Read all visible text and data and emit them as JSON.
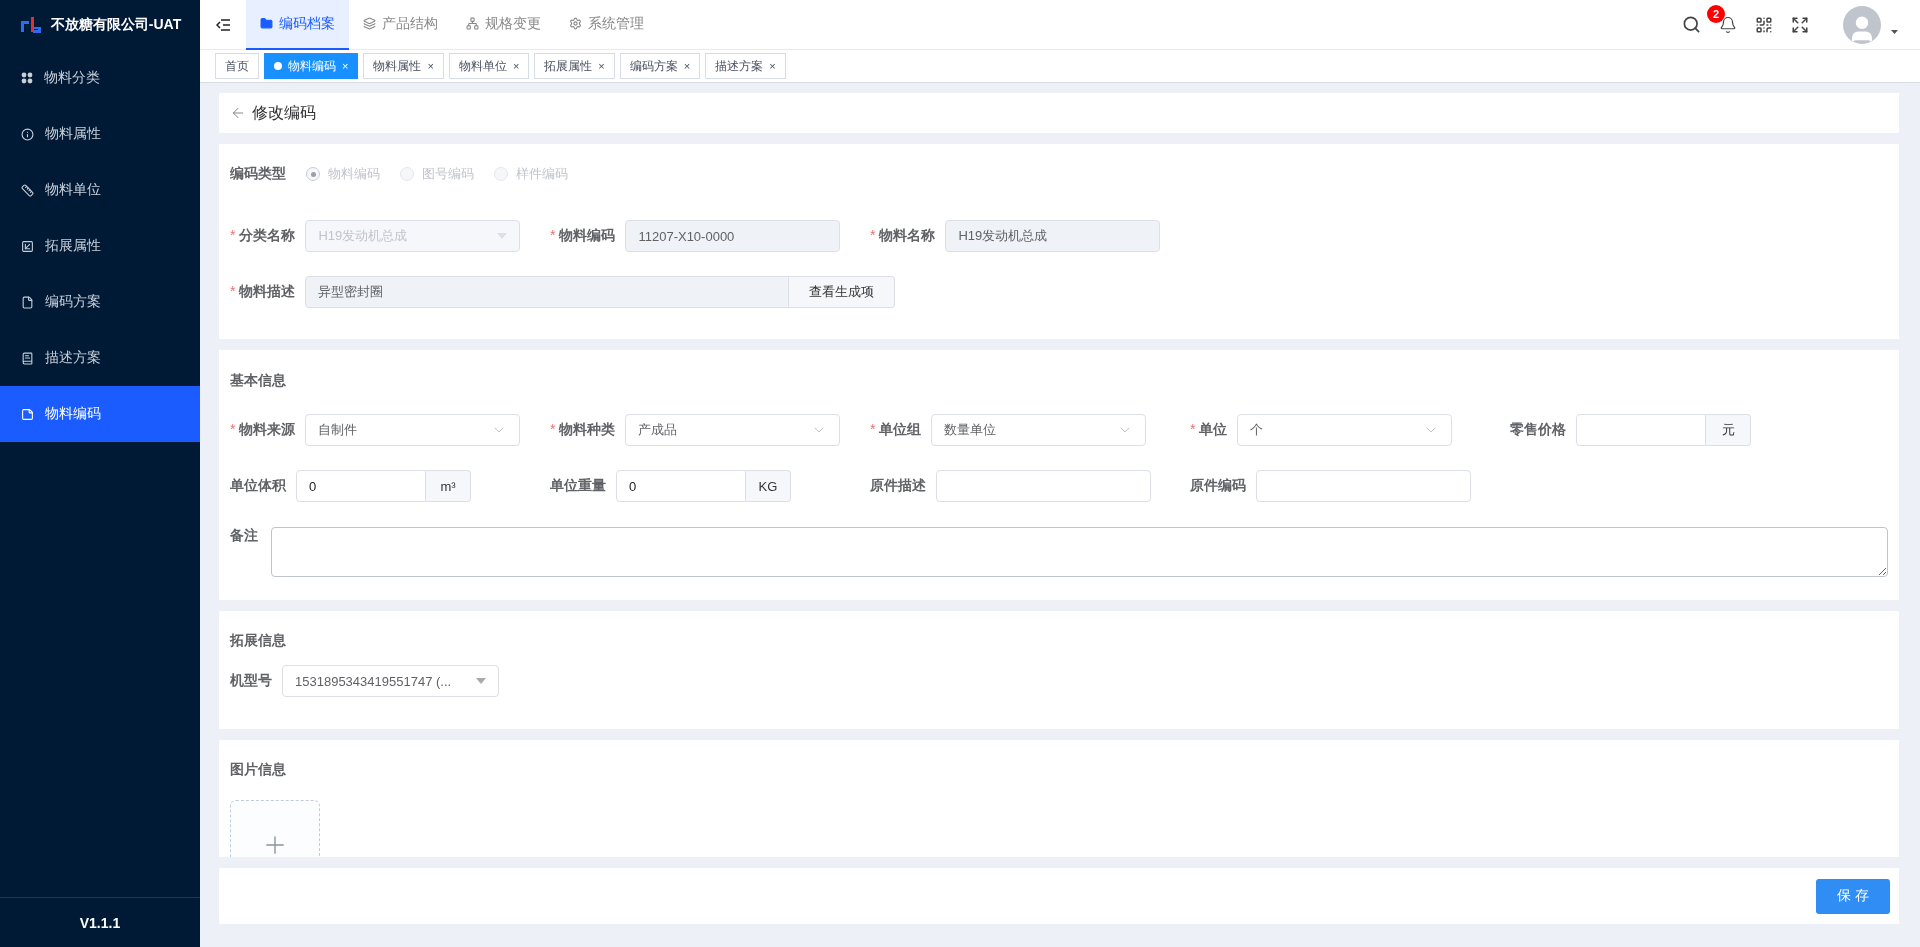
{
  "app": {
    "title": "不放糖有限公司-UAT",
    "version": "V1.1.1"
  },
  "sidebar": {
    "items": [
      {
        "label": "物料分类",
        "selected": false
      },
      {
        "label": "物料属性",
        "selected": false
      },
      {
        "label": "物料单位",
        "selected": false
      },
      {
        "label": "拓展属性",
        "selected": false
      },
      {
        "label": "编码方案",
        "selected": false
      },
      {
        "label": "描述方案",
        "selected": false
      },
      {
        "label": "物料编码",
        "selected": true
      }
    ]
  },
  "top_nav": {
    "items": [
      {
        "label": "编码档案",
        "selected": true
      },
      {
        "label": "产品结构",
        "selected": false
      },
      {
        "label": "规格变更",
        "selected": false
      },
      {
        "label": "系统管理",
        "selected": false
      }
    ]
  },
  "header": {
    "notification_count": "2"
  },
  "tags": [
    {
      "label": "首页",
      "selected": false
    },
    {
      "label": "物料编码",
      "selected": true,
      "close": "×"
    },
    {
      "label": "物料属性",
      "selected": false,
      "close": "×"
    },
    {
      "label": "物料单位",
      "selected": false,
      "close": "×"
    },
    {
      "label": "拓展属性",
      "selected": false,
      "close": "×"
    },
    {
      "label": "编码方案",
      "selected": false,
      "close": "×"
    },
    {
      "label": "描述方案",
      "selected": false,
      "close": "×"
    }
  ],
  "page": {
    "title": "修改编码"
  },
  "code_type": {
    "label": "编码类型",
    "disabled": true,
    "options": [
      {
        "label": "物料编码",
        "selected": true
      },
      {
        "label": "图号编码",
        "selected": false
      },
      {
        "label": "样件编码",
        "selected": false
      }
    ]
  },
  "identity": {
    "fields": [
      {
        "kind": "combo",
        "mark": "*",
        "label": "分类名称",
        "value": "H19发动机总成",
        "disabled": true
      },
      {
        "kind": "text",
        "mark": "*",
        "label": "物料编码",
        "value": "11207-X10-0000",
        "disabled": true
      },
      {
        "kind": "text",
        "mark": "*",
        "label": "物料名称",
        "value": "H19发动机总成",
        "disabled": true
      }
    ],
    "description": {
      "mark": "*",
      "label": "物料描述",
      "value": "异型密封圈",
      "disabled": true,
      "button": "查看生成项"
    }
  },
  "basic_info": {
    "title": "基本信息",
    "rows": [
      [
        {
          "kind": "select",
          "mark": "*",
          "label": "物料来源",
          "value": "自制件"
        },
        {
          "kind": "select",
          "mark": "*",
          "label": "物料种类",
          "value": "产成品"
        },
        {
          "kind": "select",
          "mark": "*",
          "label": "单位组",
          "value": "数量单位"
        },
        {
          "kind": "select",
          "mark": "*",
          "label": "单位",
          "value": "个"
        },
        {
          "kind": "addon",
          "label": "零售价格",
          "addon": "元"
        }
      ],
      [
        {
          "kind": "addon",
          "label": "单位体积",
          "value": "0",
          "addon": "m³"
        },
        {
          "kind": "addon",
          "label": "单位重量",
          "value": "0",
          "addon": "KG"
        },
        {
          "kind": "text",
          "label": "原件描述"
        },
        {
          "kind": "text",
          "label": "原件编码"
        }
      ]
    ],
    "remark": {
      "label": "备注"
    }
  },
  "extension": {
    "title": "拓展信息",
    "fields": [
      {
        "kind": "combo",
        "label": "机型号",
        "value": "1531895343419551747 (...",
        "disabled": false
      }
    ]
  },
  "images": {
    "title": "图片信息"
  },
  "save_button": "保 存"
}
